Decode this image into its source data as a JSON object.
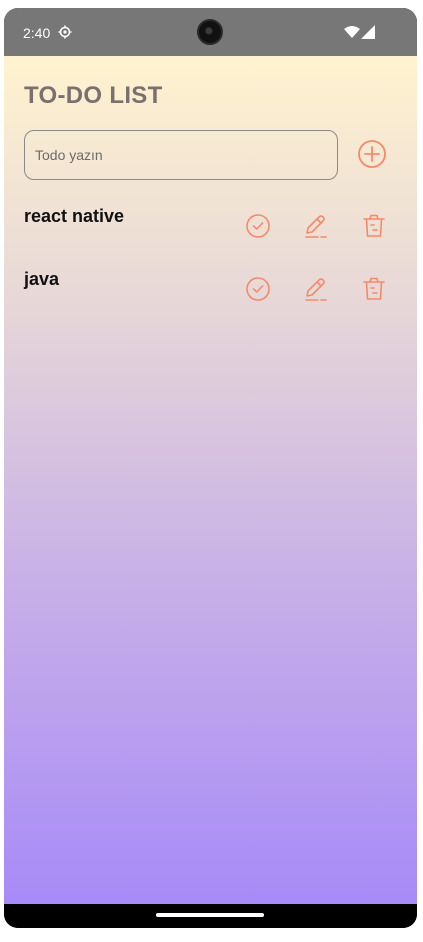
{
  "status_bar": {
    "time": "2:40",
    "icons": [
      "settings-icon",
      "wifi-icon",
      "signal-icon"
    ]
  },
  "app": {
    "title": "TO-DO LIST",
    "input": {
      "placeholder": "Todo yazın",
      "value": ""
    },
    "add_icon": "plus-circle-icon",
    "accent_color": "#f58a6a",
    "todos": [
      {
        "text": "react native",
        "icons": [
          "check-circle-icon",
          "edit-icon",
          "trash-icon"
        ]
      },
      {
        "text": "java",
        "icons": [
          "check-circle-icon",
          "edit-icon",
          "trash-icon"
        ]
      }
    ]
  }
}
